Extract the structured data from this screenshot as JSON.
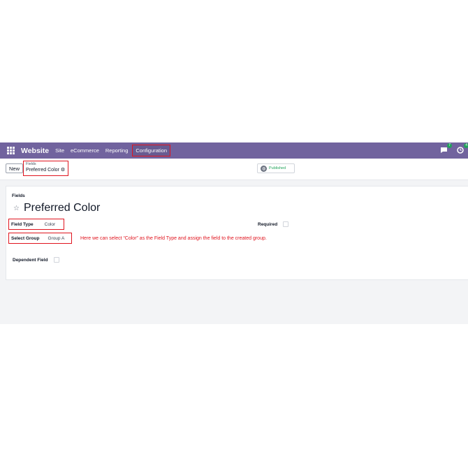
{
  "navbar": {
    "apps_icon": "apps-grid-icon",
    "brand": "Website",
    "menu": [
      "Site",
      "eCommerce",
      "Reporting",
      "Configuration"
    ],
    "active_menu": "Configuration",
    "chat_badge": "7",
    "activity_badge": "4",
    "background": "#71639e"
  },
  "controlbar": {
    "new_button": "New",
    "breadcrumb_parent": "Fields",
    "breadcrumb_current": "Preferred Color",
    "published_label": "Published"
  },
  "form": {
    "model_label": "Fields",
    "title": "Preferred Color",
    "field_type_label": "Field Type",
    "field_type_value": "Color",
    "select_group_label": "Select Group",
    "select_group_value": "Group A",
    "required_label": "Required",
    "dependent_field_label": "Dependent Field",
    "annotation": "Here we can select “Color” as the Field Type and assign the field to the created group."
  },
  "colors": {
    "highlight": "#e0141e",
    "badge": "#22a35a"
  }
}
